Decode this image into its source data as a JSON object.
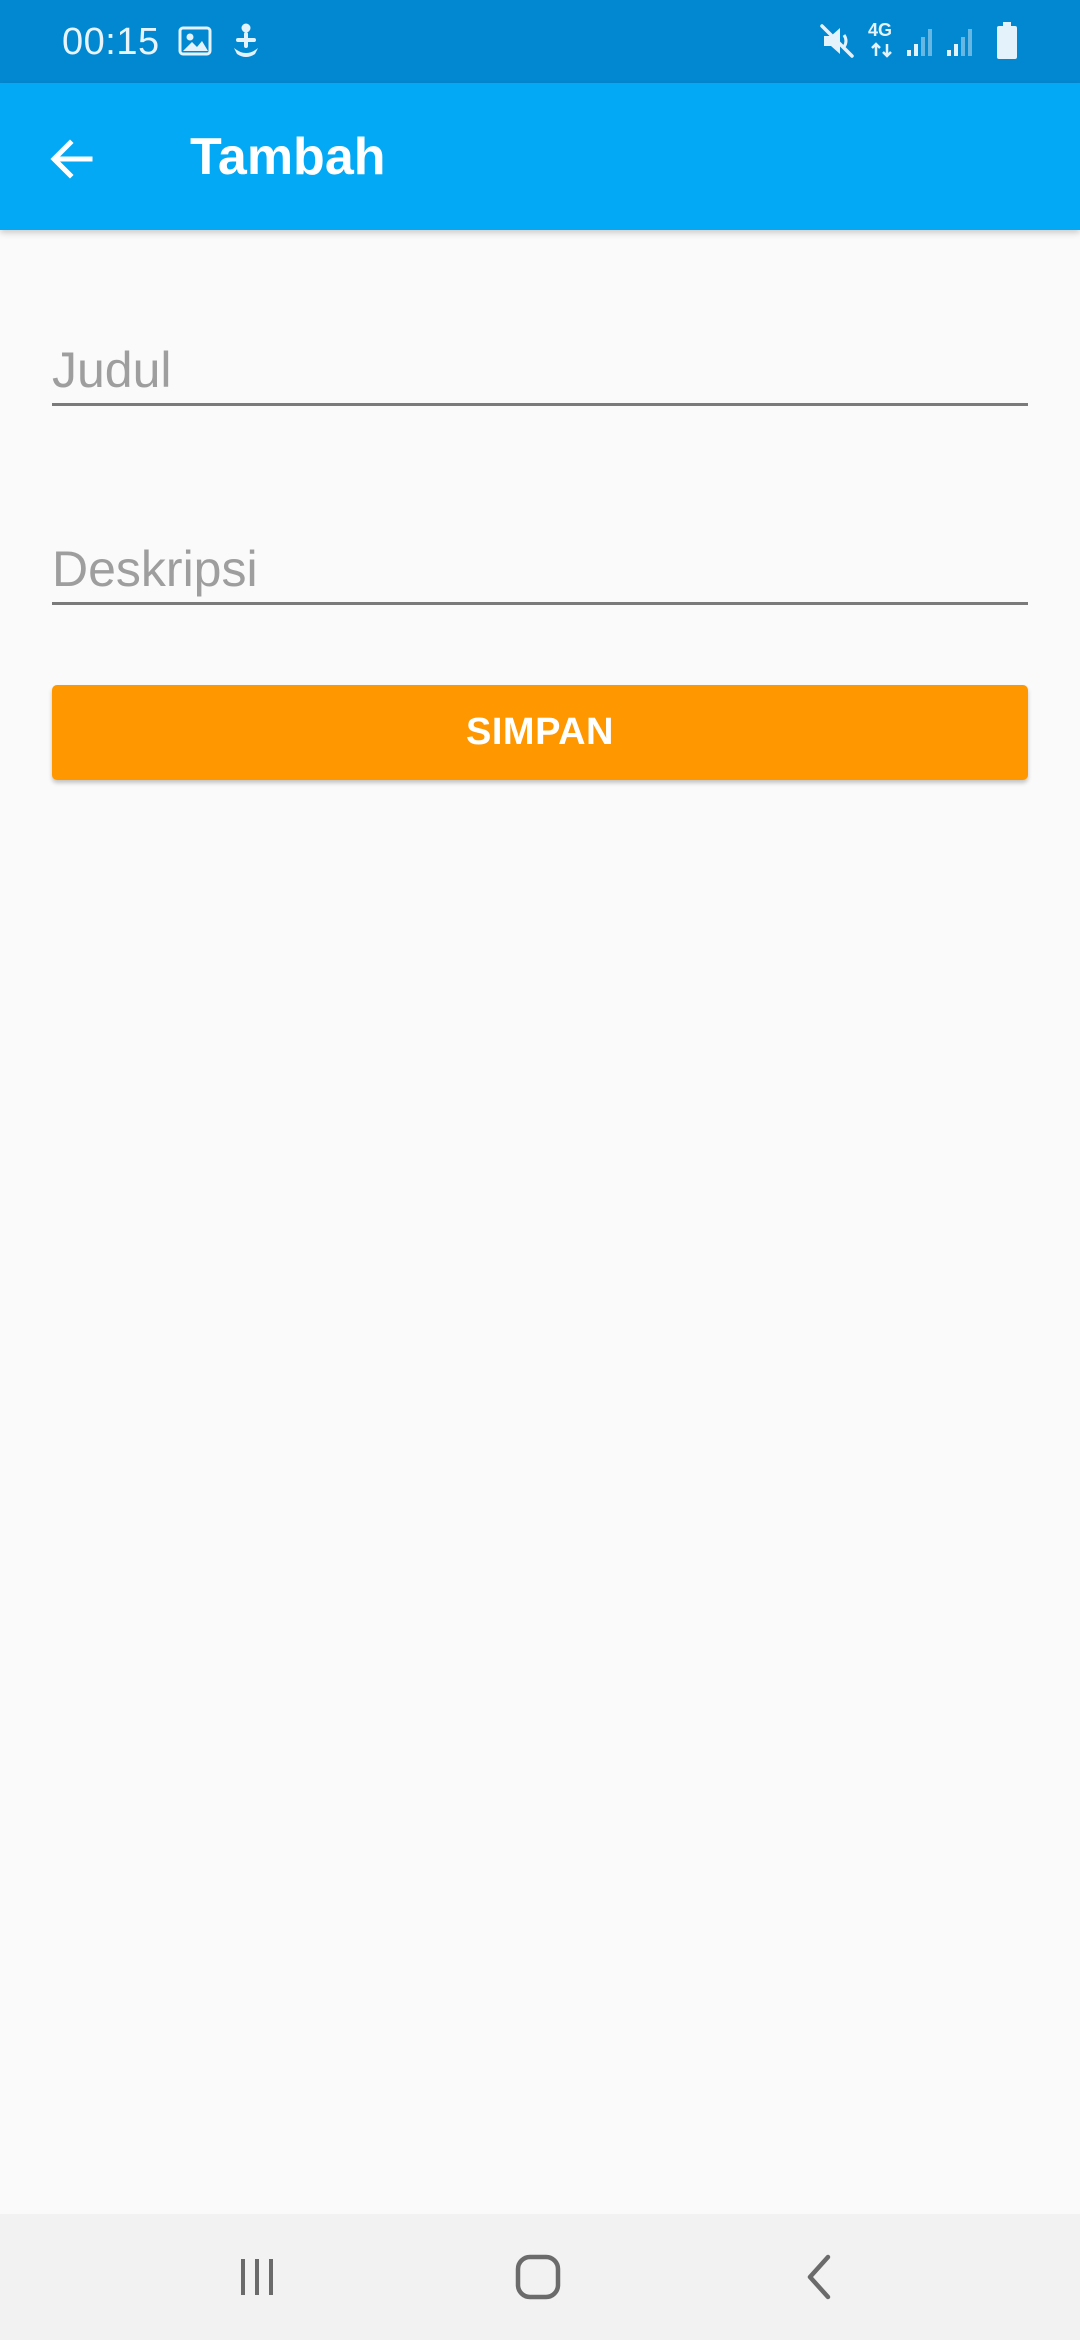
{
  "status_bar": {
    "time": "00:15",
    "network_label": "4G",
    "icons": [
      "gallery-icon",
      "notification-icon",
      "mute-icon",
      "network-4g-icon",
      "signal-icon",
      "signal-icon",
      "battery-icon"
    ]
  },
  "app_bar": {
    "title": "Tambah",
    "back_icon": "arrow-back-icon"
  },
  "form": {
    "title_field": {
      "value": "",
      "placeholder": "Judul"
    },
    "description_field": {
      "value": "",
      "placeholder": "Deskripsi"
    },
    "save_label": "SIMPAN"
  },
  "nav_bar": {
    "icons": [
      "recents-icon",
      "home-icon",
      "back-icon"
    ]
  },
  "colors": {
    "status_bar": "#0288d1",
    "app_bar": "#03a9f4",
    "accent": "#ff9800",
    "background": "#fafafa",
    "nav_bar": "#f2f2f2"
  }
}
